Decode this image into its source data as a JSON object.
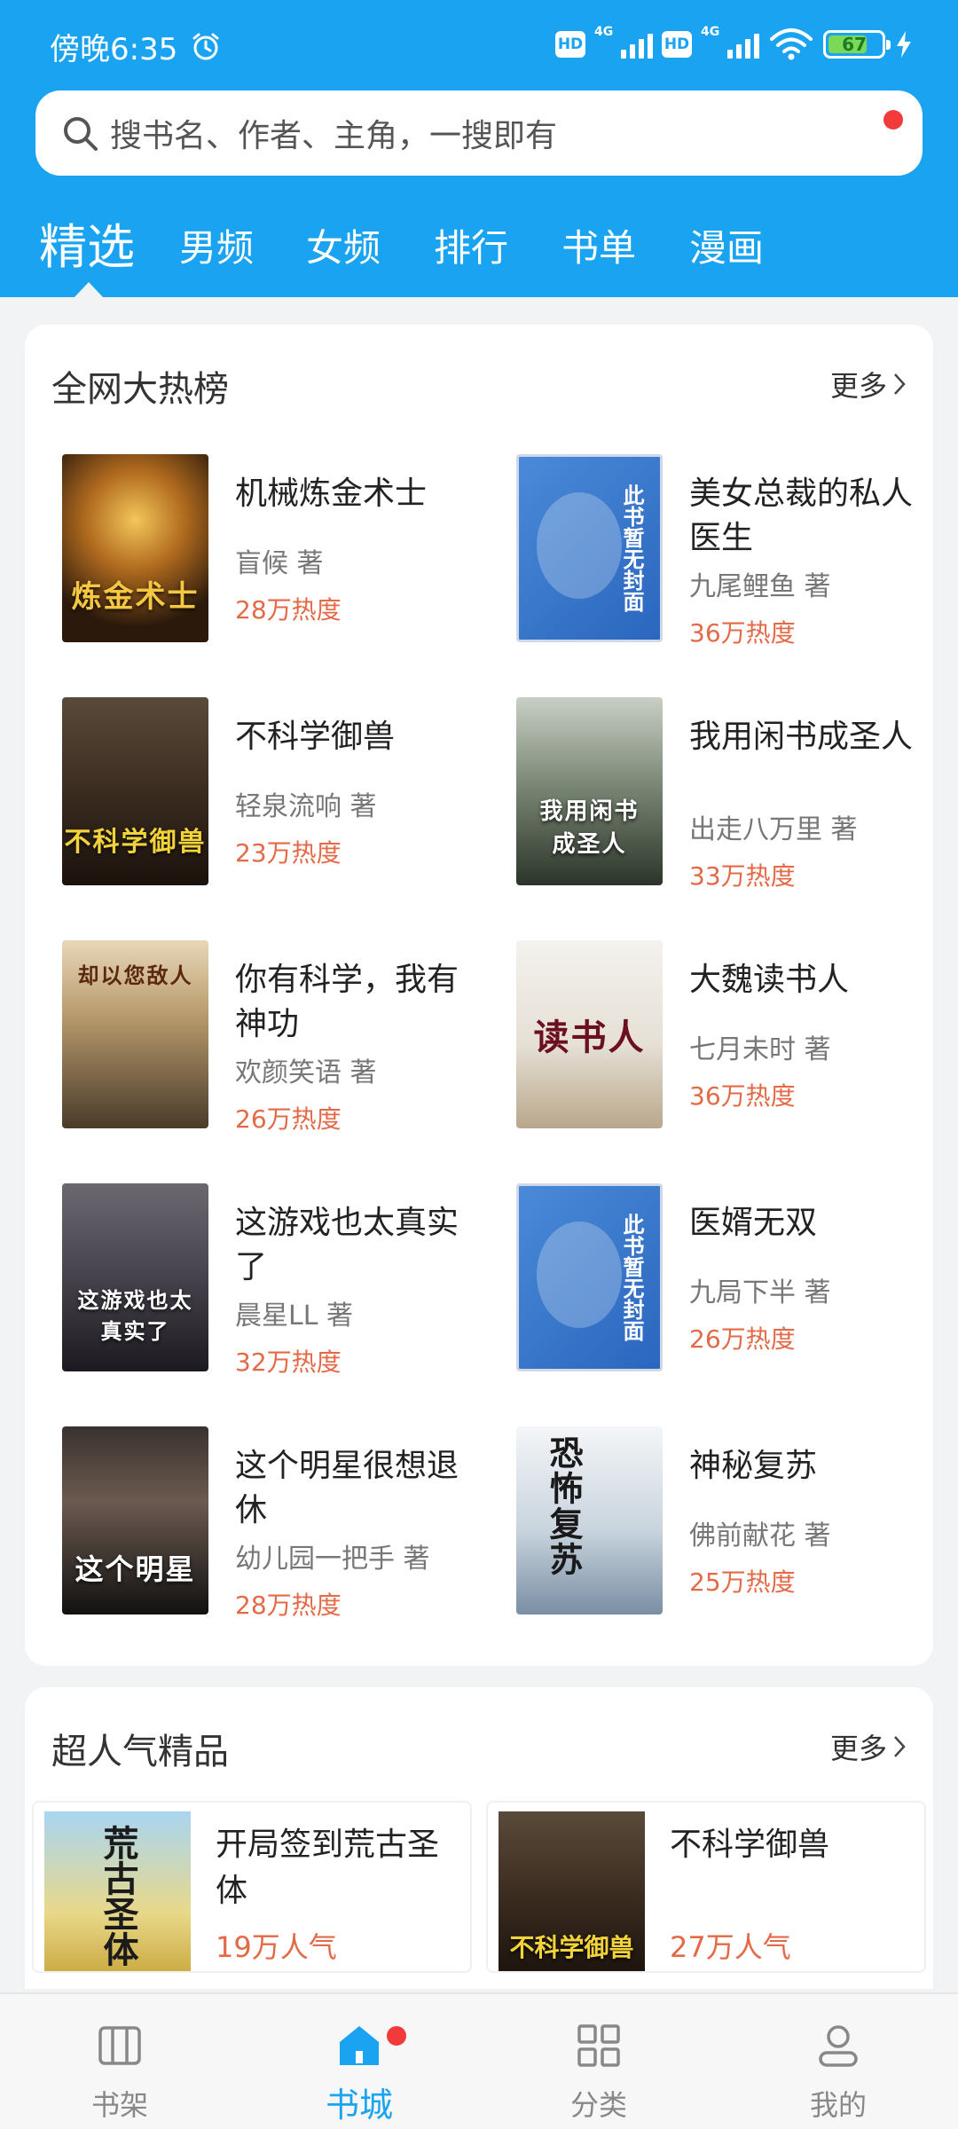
{
  "status_bar": {
    "time": "傍晚6:35",
    "hd1": "HD",
    "net1": "4G",
    "hd2": "HD",
    "net2": "4G",
    "battery": "67"
  },
  "search": {
    "placeholder": "搜书名、作者、主角，一搜即有"
  },
  "tabs": [
    {
      "label": "精选",
      "active": true
    },
    {
      "label": "男频"
    },
    {
      "label": "女频"
    },
    {
      "label": "排行"
    },
    {
      "label": "书单"
    },
    {
      "label": "漫画"
    }
  ],
  "hot_list": {
    "title": "全网大热榜",
    "more": "更多",
    "books": [
      {
        "title": "机械炼金术士",
        "author": "盲候 著",
        "heat": "28万热度",
        "cover_text": "炼金术士"
      },
      {
        "title": "美女总裁的私人医生",
        "author": "九尾鲤鱼 著",
        "heat": "36万热度",
        "cover_text": "此书暂无封面"
      },
      {
        "title": "不科学御兽",
        "author": "轻泉流响 著",
        "heat": "23万热度",
        "cover_text": "不科学御兽"
      },
      {
        "title": "我用闲书成圣人",
        "author": "出走八万里 著",
        "heat": "33万热度",
        "cover_text": "我用闲书成圣人"
      },
      {
        "title": "你有科学，我有神功",
        "author": "欢颜笑语 著",
        "heat": "26万热度",
        "cover_text": "却以您敌人"
      },
      {
        "title": "大魏读书人",
        "author": "七月未时 著",
        "heat": "36万热度",
        "cover_text": "读书人"
      },
      {
        "title": "这游戏也太真实了",
        "author": "晨星LL 著",
        "heat": "32万热度",
        "cover_text": "这游戏也太真实了"
      },
      {
        "title": "医婿无双",
        "author": "九局下半 著",
        "heat": "26万热度",
        "cover_text": "此书暂无封面"
      },
      {
        "title": "这个明星很想退休",
        "author": "幼儿园一把手 著",
        "heat": "28万热度",
        "cover_text": "这个明星"
      },
      {
        "title": "神秘复苏",
        "author": "佛前献花 著",
        "heat": "25万热度",
        "cover_text": "恐怖复苏"
      }
    ]
  },
  "popular": {
    "title": "超人气精品",
    "more": "更多",
    "books": [
      {
        "title": "开局签到荒古圣体",
        "heat": "19万人气",
        "cover_text": "荒古圣体"
      },
      {
        "title": "不科学御兽",
        "heat": "27万人气",
        "cover_text": "不科学御兽"
      }
    ]
  },
  "bottom_nav": [
    {
      "label": "书架",
      "icon": "bookshelf-icon"
    },
    {
      "label": "书城",
      "icon": "home-icon",
      "active": true
    },
    {
      "label": "分类",
      "icon": "grid-icon"
    },
    {
      "label": "我的",
      "icon": "user-icon"
    }
  ],
  "colors": {
    "primary": "#1aa3f0",
    "heat": "#e46a47",
    "badge": "#f23a3a"
  }
}
